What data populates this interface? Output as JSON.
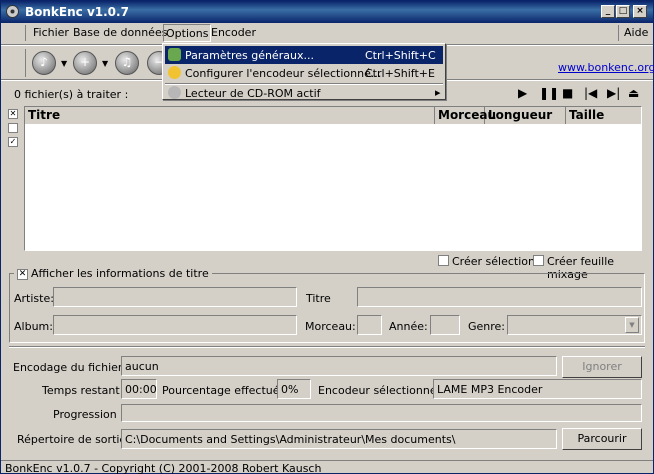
{
  "window": {
    "title": "BonkEnc v1.0.7"
  },
  "menu": {
    "items": [
      "Fichier",
      "Base de données",
      "Options",
      "Encoder"
    ],
    "help": "Aide"
  },
  "options_menu": [
    {
      "label": "Paramètres généraux...",
      "shortcut": "Ctrl+Shift+C",
      "icon": "settings-icon"
    },
    {
      "label": "Configurer l'encodeur sélectionné...",
      "shortcut": "Ctrl+Shift+E",
      "icon": "encoder-config-icon"
    },
    {
      "label": "Lecteur de CD-ROM actif",
      "shortcut": "",
      "icon": "cdrom-icon",
      "arrow": "▸"
    }
  ],
  "toolbar": {
    "website": "www.bonkenc.org"
  },
  "list": {
    "count_label": "0 fichier(s) à traiter :",
    "columns": [
      "Titre",
      "Morceau",
      "Longueur",
      "Taille"
    ]
  },
  "options": {
    "create_selection": "Créer sélection",
    "create_playlist": "Créer feuille mixage",
    "show_info": "Afficher les informations de titre"
  },
  "info": {
    "artist": "Artiste:",
    "title": "Titre",
    "album": "Album:",
    "track": "Morceau:",
    "year": "Année:",
    "genre": "Genre:"
  },
  "status": {
    "encoding_label": "Encodage du fichier :",
    "encoding_value": "aucun",
    "ignore_label": "Ignorer",
    "time_label": "Temps restant :",
    "time_value": "00:00",
    "percent_label": "Pourcentage effectué :",
    "percent_value": "0%",
    "encoder_label": "Encodeur sélectionné :",
    "encoder_value": "LAME MP3 Encoder",
    "progress_label": "Progression :",
    "progress": 0,
    "outdir_label": "Répertoire de sortie :",
    "outdir_value": "C:\\Documents and Settings\\Administrateur\\Mes documents\\",
    "browse_label": "Parcourir"
  },
  "statusbar": "BonkEnc v1.0.7 - Copyright (C) 2001-2008 Robert Kausch"
}
